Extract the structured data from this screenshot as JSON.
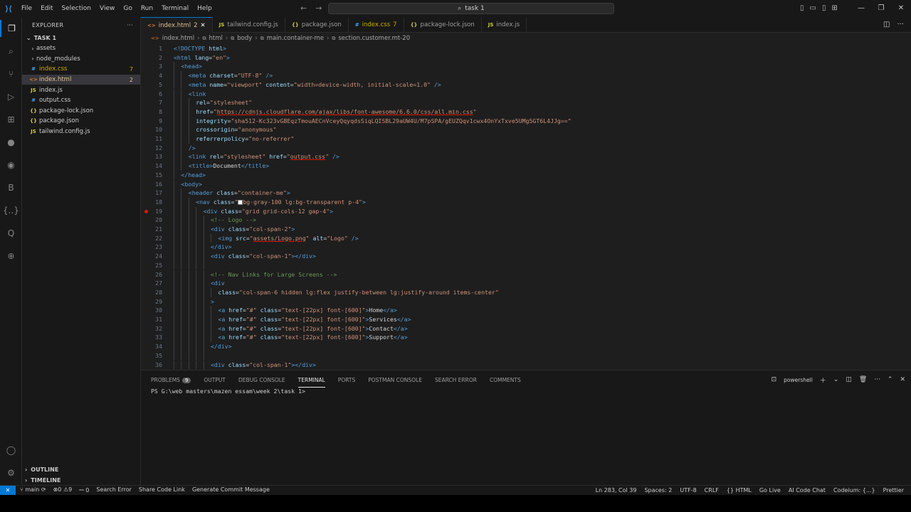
{
  "titlebar": {
    "menu": [
      "File",
      "Edit",
      "Selection",
      "View",
      "Go",
      "Run",
      "Terminal",
      "Help"
    ],
    "search_text": "task 1"
  },
  "explorer": {
    "header": "EXPLORER",
    "folder": "TASK 1",
    "items": [
      {
        "name": "assets",
        "kind": "folder",
        "color": "#cccccc",
        "badge": ""
      },
      {
        "name": "node_modules",
        "kind": "folder",
        "color": "#cccccc",
        "badge": ""
      },
      {
        "name": "index.css",
        "kind": "css",
        "color": "#cca700",
        "badge": "7"
      },
      {
        "name": "index.html",
        "kind": "html",
        "color": "#e2c08d",
        "badge": "2"
      },
      {
        "name": "index.js",
        "kind": "js",
        "color": "#cccccc",
        "badge": ""
      },
      {
        "name": "output.css",
        "kind": "css",
        "color": "#cccccc",
        "badge": ""
      },
      {
        "name": "package-lock.json",
        "kind": "json",
        "color": "#cccccc",
        "badge": ""
      },
      {
        "name": "package.json",
        "kind": "json",
        "color": "#cccccc",
        "badge": ""
      },
      {
        "name": "tailwind.config.js",
        "kind": "js",
        "color": "#cccccc",
        "badge": ""
      }
    ],
    "outline": "OUTLINE",
    "timeline": "TIMELINE"
  },
  "tabs": [
    {
      "name": "index.html",
      "suffix": "2",
      "kind": "html",
      "active": true
    },
    {
      "name": "tailwind.config.js",
      "suffix": "",
      "kind": "js",
      "active": false
    },
    {
      "name": "package.json",
      "suffix": "",
      "kind": "json",
      "active": false
    },
    {
      "name": "index.css",
      "suffix": "7",
      "kind": "css",
      "active": false
    },
    {
      "name": "package-lock.json",
      "suffix": "",
      "kind": "json",
      "active": false
    },
    {
      "name": "index.js",
      "suffix": "",
      "kind": "js",
      "active": false
    }
  ],
  "breadcrumb": [
    "index.html",
    "html",
    "body",
    "main.container-me",
    "section.customer.mt-20"
  ],
  "code_lines": [
    {
      "n": "1",
      "indent": 0,
      "parts": [
        [
          "t-tag",
          "<!DOCTYPE "
        ],
        [
          "t-attr",
          "html"
        ],
        [
          "t-tag",
          ">"
        ]
      ]
    },
    {
      "n": "2",
      "indent": 0,
      "parts": [
        [
          "t-tag",
          "<html "
        ],
        [
          "t-attr",
          "lang"
        ],
        [
          "t-txt",
          "="
        ],
        [
          "t-str",
          "\"en\""
        ],
        [
          "t-tag",
          ">"
        ]
      ]
    },
    {
      "n": "3",
      "indent": 1,
      "parts": [
        [
          "t-tag",
          "<head>"
        ]
      ]
    },
    {
      "n": "4",
      "indent": 2,
      "parts": [
        [
          "t-tag",
          "<meta "
        ],
        [
          "t-attr",
          "charset"
        ],
        [
          "t-txt",
          "="
        ],
        [
          "t-str",
          "\"UTF-8\""
        ],
        [
          "t-tag",
          " />"
        ]
      ]
    },
    {
      "n": "5",
      "indent": 2,
      "parts": [
        [
          "t-tag",
          "<meta "
        ],
        [
          "t-attr",
          "name"
        ],
        [
          "t-txt",
          "="
        ],
        [
          "t-str",
          "\"viewport\""
        ],
        [
          "t-attr",
          " content"
        ],
        [
          "t-txt",
          "="
        ],
        [
          "t-str",
          "\"width=device-width, initial-scale=1.0\""
        ],
        [
          "t-tag",
          " />"
        ]
      ]
    },
    {
      "n": "6",
      "indent": 2,
      "parts": [
        [
          "t-tag",
          "<link"
        ]
      ]
    },
    {
      "n": "7",
      "indent": 3,
      "parts": [
        [
          "t-attr",
          "rel"
        ],
        [
          "t-txt",
          "="
        ],
        [
          "t-str",
          "\"stylesheet\""
        ]
      ]
    },
    {
      "n": "8",
      "indent": 3,
      "parts": [
        [
          "t-attr",
          "href"
        ],
        [
          "t-txt",
          "="
        ],
        [
          "t-str",
          "\""
        ],
        [
          "t-link",
          "https://cdnjs.cloudflare.com/ajax/libs/font-awesome/6.6.0/css/all.min.css"
        ],
        [
          "t-str",
          "\""
        ]
      ]
    },
    {
      "n": "9",
      "indent": 3,
      "parts": [
        [
          "t-attr",
          "integrity"
        ],
        [
          "t-txt",
          "="
        ],
        [
          "t-str",
          "\"sha512-Kc323vGBEqzTmouAECnVceyQqyqdsSiqLQISBL29aUW4U/M7pSPA/gEUZQqv1cwx4OnYxTxve5UMg5GT6L4JJg==\""
        ]
      ]
    },
    {
      "n": "10",
      "indent": 3,
      "parts": [
        [
          "t-attr",
          "crossorigin"
        ],
        [
          "t-txt",
          "="
        ],
        [
          "t-str",
          "\"anonymous\""
        ]
      ]
    },
    {
      "n": "11",
      "indent": 3,
      "parts": [
        [
          "t-attr",
          "referrerpolicy"
        ],
        [
          "t-txt",
          "="
        ],
        [
          "t-str",
          "\"no-referrer\""
        ]
      ]
    },
    {
      "n": "12",
      "indent": 2,
      "parts": [
        [
          "t-tag",
          "/>"
        ]
      ]
    },
    {
      "n": "13",
      "indent": 2,
      "parts": [
        [
          "t-tag",
          "<link "
        ],
        [
          "t-attr",
          "rel"
        ],
        [
          "t-txt",
          "="
        ],
        [
          "t-str",
          "\"stylesheet\""
        ],
        [
          "t-attr",
          " href"
        ],
        [
          "t-txt",
          "="
        ],
        [
          "t-str",
          "\""
        ],
        [
          "t-link",
          "output.css"
        ],
        [
          "t-str",
          "\""
        ],
        [
          "t-tag",
          " />"
        ]
      ]
    },
    {
      "n": "14",
      "indent": 2,
      "parts": [
        [
          "t-tag",
          "<title>"
        ],
        [
          "t-txt",
          "Document"
        ],
        [
          "t-tag",
          "</title>"
        ]
      ]
    },
    {
      "n": "15",
      "indent": 1,
      "parts": [
        [
          "t-tag",
          "</head>"
        ]
      ]
    },
    {
      "n": "16",
      "indent": 1,
      "parts": [
        [
          "t-tag",
          "<body>"
        ]
      ]
    },
    {
      "n": "17",
      "indent": 2,
      "parts": [
        [
          "t-tag",
          "<header "
        ],
        [
          "t-attr",
          "class"
        ],
        [
          "t-txt",
          "="
        ],
        [
          "t-str",
          "\"container-me\""
        ],
        [
          "t-tag",
          ">"
        ]
      ]
    },
    {
      "n": "18",
      "indent": 3,
      "parts": [
        [
          "t-tag",
          "<nav "
        ],
        [
          "t-attr",
          "class"
        ],
        [
          "t-txt",
          "="
        ],
        [
          "t-str",
          "\""
        ],
        [
          "box",
          ""
        ],
        [
          "t-str",
          "bg-gray-100 lg:bg-transparent p-4\""
        ],
        [
          "t-tag",
          ">"
        ]
      ]
    },
    {
      "n": "19",
      "indent": 4,
      "bp": true,
      "parts": [
        [
          "t-tag",
          "<div "
        ],
        [
          "t-attr",
          "class"
        ],
        [
          "t-txt",
          "="
        ],
        [
          "t-str",
          "\"grid grid-cols-12 gap-4\""
        ],
        [
          "t-tag",
          ">"
        ]
      ]
    },
    {
      "n": "20",
      "indent": 5,
      "parts": [
        [
          "t-com",
          "<!-- Logo -->"
        ]
      ]
    },
    {
      "n": "21",
      "indent": 5,
      "parts": [
        [
          "t-tag",
          "<div "
        ],
        [
          "t-attr",
          "class"
        ],
        [
          "t-txt",
          "="
        ],
        [
          "t-str",
          "\"col-span-2\""
        ],
        [
          "t-tag",
          ">"
        ]
      ]
    },
    {
      "n": "22",
      "indent": 6,
      "parts": [
        [
          "t-tag",
          "<img "
        ],
        [
          "t-attr",
          "src"
        ],
        [
          "t-txt",
          "="
        ],
        [
          "t-str",
          "\""
        ],
        [
          "t-link",
          "assets/Logo.png"
        ],
        [
          "t-str",
          "\""
        ],
        [
          "t-attr",
          " alt"
        ],
        [
          "t-txt",
          "="
        ],
        [
          "t-str",
          "\"Logo\""
        ],
        [
          "t-tag",
          " />"
        ]
      ]
    },
    {
      "n": "23",
      "indent": 5,
      "parts": [
        [
          "t-tag",
          "</div>"
        ]
      ]
    },
    {
      "n": "24",
      "indent": 5,
      "parts": [
        [
          "t-tag",
          "<div "
        ],
        [
          "t-attr",
          "class"
        ],
        [
          "t-txt",
          "="
        ],
        [
          "t-str",
          "\"col-span-1\""
        ],
        [
          "t-tag",
          "></div>"
        ]
      ]
    },
    {
      "n": "25",
      "indent": 5,
      "parts": []
    },
    {
      "n": "26",
      "indent": 5,
      "parts": [
        [
          "t-com",
          "<!-- Nav Links for Large Screens -->"
        ]
      ]
    },
    {
      "n": "27",
      "indent": 5,
      "parts": [
        [
          "t-tag",
          "<div"
        ]
      ]
    },
    {
      "n": "28",
      "indent": 6,
      "parts": [
        [
          "t-attr",
          "class"
        ],
        [
          "t-txt",
          "="
        ],
        [
          "t-str",
          "\"col-span-6 hidden lg:flex justify-between lg:justify-around items-center\""
        ]
      ]
    },
    {
      "n": "29",
      "indent": 5,
      "parts": [
        [
          "t-tag",
          ">"
        ]
      ]
    },
    {
      "n": "30",
      "indent": 6,
      "parts": [
        [
          "t-tag",
          "<a "
        ],
        [
          "t-attr",
          "href"
        ],
        [
          "t-txt",
          "="
        ],
        [
          "t-str",
          "\"#\""
        ],
        [
          "t-attr",
          " class"
        ],
        [
          "t-txt",
          "="
        ],
        [
          "t-str",
          "\"text-[22px] font-[600]\""
        ],
        [
          "t-tag",
          ">"
        ],
        [
          "t-txt",
          "Home"
        ],
        [
          "t-tag",
          "</a>"
        ]
      ]
    },
    {
      "n": "31",
      "indent": 6,
      "parts": [
        [
          "t-tag",
          "<a "
        ],
        [
          "t-attr",
          "href"
        ],
        [
          "t-txt",
          "="
        ],
        [
          "t-str",
          "\"#\""
        ],
        [
          "t-attr",
          " class"
        ],
        [
          "t-txt",
          "="
        ],
        [
          "t-str",
          "\"text-[22px] font-[600]\""
        ],
        [
          "t-tag",
          ">"
        ],
        [
          "t-txt",
          "Services"
        ],
        [
          "t-tag",
          "</a>"
        ]
      ]
    },
    {
      "n": "32",
      "indent": 6,
      "parts": [
        [
          "t-tag",
          "<a "
        ],
        [
          "t-attr",
          "href"
        ],
        [
          "t-txt",
          "="
        ],
        [
          "t-str",
          "\"#\""
        ],
        [
          "t-attr",
          " class"
        ],
        [
          "t-txt",
          "="
        ],
        [
          "t-str",
          "\"text-[22px] font-[600]\""
        ],
        [
          "t-tag",
          ">"
        ],
        [
          "t-txt",
          "Contact"
        ],
        [
          "t-tag",
          "</a>"
        ]
      ]
    },
    {
      "n": "33",
      "indent": 6,
      "parts": [
        [
          "t-tag",
          "<a "
        ],
        [
          "t-attr",
          "href"
        ],
        [
          "t-txt",
          "="
        ],
        [
          "t-str",
          "\"#\""
        ],
        [
          "t-attr",
          " class"
        ],
        [
          "t-txt",
          "="
        ],
        [
          "t-str",
          "\"text-[22px] font-[600]\""
        ],
        [
          "t-tag",
          ">"
        ],
        [
          "t-txt",
          "Support"
        ],
        [
          "t-tag",
          "</a>"
        ]
      ]
    },
    {
      "n": "34",
      "indent": 5,
      "parts": [
        [
          "t-tag",
          "</div>"
        ]
      ]
    },
    {
      "n": "35",
      "indent": 5,
      "parts": []
    },
    {
      "n": "36",
      "indent": 5,
      "parts": [
        [
          "t-tag",
          "<div "
        ],
        [
          "t-attr",
          "class"
        ],
        [
          "t-txt",
          "="
        ],
        [
          "t-str",
          "\"col-span-1\""
        ],
        [
          "t-tag",
          "></div>"
        ]
      ]
    }
  ],
  "panel": {
    "tabs": [
      {
        "label": "PROBLEMS",
        "count": "9",
        "active": false
      },
      {
        "label": "OUTPUT",
        "count": "",
        "active": false
      },
      {
        "label": "DEBUG CONSOLE",
        "count": "",
        "active": false
      },
      {
        "label": "TERMINAL",
        "count": "",
        "active": true
      },
      {
        "label": "PORTS",
        "count": "",
        "active": false
      },
      {
        "label": "POSTMAN CONSOLE",
        "count": "",
        "active": false
      },
      {
        "label": "SEARCH ERROR",
        "count": "",
        "active": false
      },
      {
        "label": "COMMENTS",
        "count": "",
        "active": false
      }
    ],
    "shell": "powershell",
    "prompt": "PS G:\\web masters\\mazen essam\\week 2\\task 1>"
  },
  "statusbar": {
    "branch": "main",
    "errors": "0",
    "warnings": "9",
    "ports": "0",
    "left_items": [
      "Search Error",
      "Share Code Link",
      "Generate Commit Message"
    ],
    "right_items": [
      "Ln 283, Col 39",
      "Spaces: 2",
      "UTF-8",
      "CRLF",
      "{} HTML",
      "Go Live",
      "AI Code Chat",
      "Codeium: {...}",
      "Prettier"
    ]
  },
  "colors": {
    "accent": "#0078d4",
    "breakpoint": "#e51400",
    "modified": "#e2c08d",
    "warning": "#cca700"
  }
}
